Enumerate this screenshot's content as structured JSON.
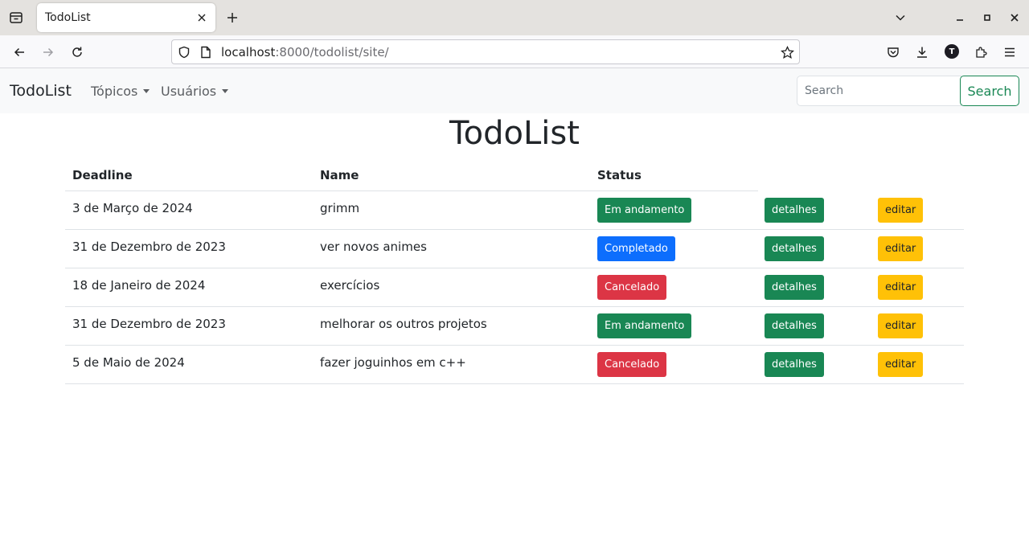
{
  "browser": {
    "tab_title": "TodoList",
    "url_host": "localhost",
    "url_path": ":8000/todolist/site/",
    "avatar_letter": "T"
  },
  "navbar": {
    "brand": "TodoList",
    "menus": [
      "Tópicos",
      "Usuários"
    ],
    "search_placeholder": "Search",
    "search_button": "Search"
  },
  "page": {
    "title": "TodoList"
  },
  "table": {
    "columns": [
      "Deadline",
      "Name",
      "Status"
    ],
    "rows": [
      {
        "deadline": "3 de Março de 2024",
        "name": "grimm",
        "status": "Em andamento",
        "action_details": "detalhes",
        "action_edit": "editar"
      },
      {
        "deadline": "31 de Dezembro de 2023",
        "name": "ver novos animes",
        "status": "Completado",
        "action_details": "detalhes",
        "action_edit": "editar"
      },
      {
        "deadline": "18 de Janeiro de 2024",
        "name": "exercícios",
        "status": "Cancelado",
        "action_details": "detalhes",
        "action_edit": "editar"
      },
      {
        "deadline": "31 de Dezembro de 2023",
        "name": "melhorar os outros projetos",
        "status": "Em andamento",
        "action_details": "detalhes",
        "action_edit": "editar"
      },
      {
        "deadline": "5 de Maio de 2024",
        "name": "fazer joguinhos em c++",
        "status": "Cancelado",
        "action_details": "detalhes",
        "action_edit": "editar"
      }
    ]
  },
  "colors": {
    "status_in_progress": "#198754",
    "status_completed": "#0d6efd",
    "status_cancelled": "#dc3545",
    "details_button": "#198754",
    "edit_button": "#ffc107"
  },
  "icons": [
    "tab-list-icon",
    "close-icon",
    "plus-icon",
    "chevron-down-icon",
    "minimize-icon",
    "maximize-icon",
    "back-arrow-icon",
    "forward-arrow-icon",
    "reload-icon",
    "shield-icon",
    "page-icon",
    "star-icon",
    "pocket-icon",
    "download-icon",
    "extensions-icon",
    "menu-icon"
  ]
}
